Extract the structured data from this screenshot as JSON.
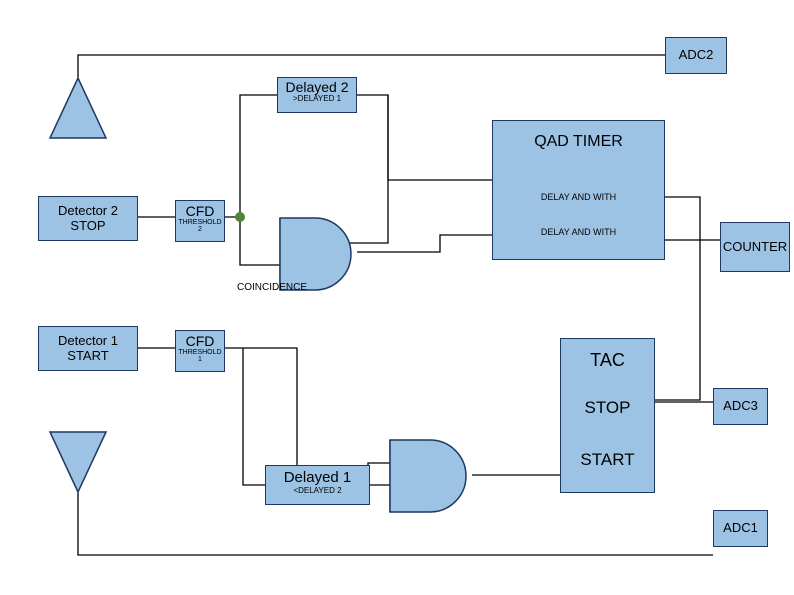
{
  "adc2": "ADC2",
  "adc3": "ADC3",
  "adc1": "ADC1",
  "counter": "COUNTER",
  "qad_title": "QAD TIMER",
  "qad_line1": "DELAY AND WITH",
  "qad_line2": "DELAY AND WITH",
  "tac_title": "TAC",
  "tac_stop": "STOP",
  "tac_start": "START",
  "delayed2_title": "Delayed 2",
  "delayed2_sub": ">DELAYED 1",
  "delayed1_title": "Delayed 1",
  "delayed1_sub": "<DELAYED 2",
  "det2_l1": "Detector 2",
  "det2_l2": "STOP",
  "det1_l1": "Detector 1",
  "det1_l2": "START",
  "cfd2_title": "CFD",
  "cfd2_sub": "THRESHOLD 2",
  "cfd1_title": "CFD",
  "cfd1_sub": "THRESHOLD 1",
  "coincidence": "COINCIDENCE"
}
